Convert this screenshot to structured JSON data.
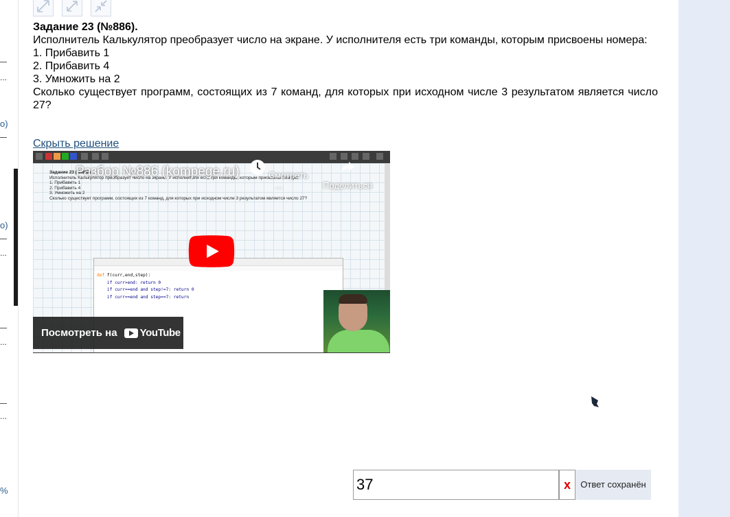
{
  "toolbar_icons": [
    "expand-diagonal-icon",
    "resize-diagonal-icon",
    "collapse-diagonal-icon"
  ],
  "task": {
    "title": "Задание 23 (№886).",
    "lines": [
      "Исполнитель Калькулятор преобразует число на экране. У исполнителя есть три команды, которым присвоены номера:",
      "1. Прибавить 1",
      "2. Прибавить 4",
      "3. Умножить на 2",
      "Сколько существует программ, состоящих из 7 команд, для которых при исходном числе 3 результатом является число 27?"
    ]
  },
  "toggle_solution": "Скрыть решение",
  "video": {
    "title": "Разбор №886 (kompege.ru)",
    "watch_later": "Смотреть ...",
    "share": "Поделиться",
    "watch_on": "Посмотреть на",
    "youtube": "YouTube",
    "mini_task": {
      "title": "Задание 23 (№886)",
      "lines": [
        "Исполнитель Калькулятор преобразует число на экране. У исполнителя есть три команды, которым присвоены номера:",
        "1. Прибавить 1",
        "2. Прибавить 4",
        "3. Умножить на 2",
        "Сколько существует программ, состоящих из 7 команд, для которых при исходном числе 3 результатом является число 27?"
      ]
    },
    "code": {
      "line1_kw": "def",
      "line1_rest": " f(curr,end,step):",
      "line2": "if curr>end: return 0",
      "line3": "if curr==end and step!=7: return 0",
      "line4": "if curr==end and step==7: return"
    }
  },
  "answer": {
    "value": "37",
    "clear": "x",
    "status": "Ответ сохранён"
  },
  "left_fragments": [
    "...",
    "о)",
    "о)",
    "...",
    "...",
    "...",
    "%"
  ]
}
